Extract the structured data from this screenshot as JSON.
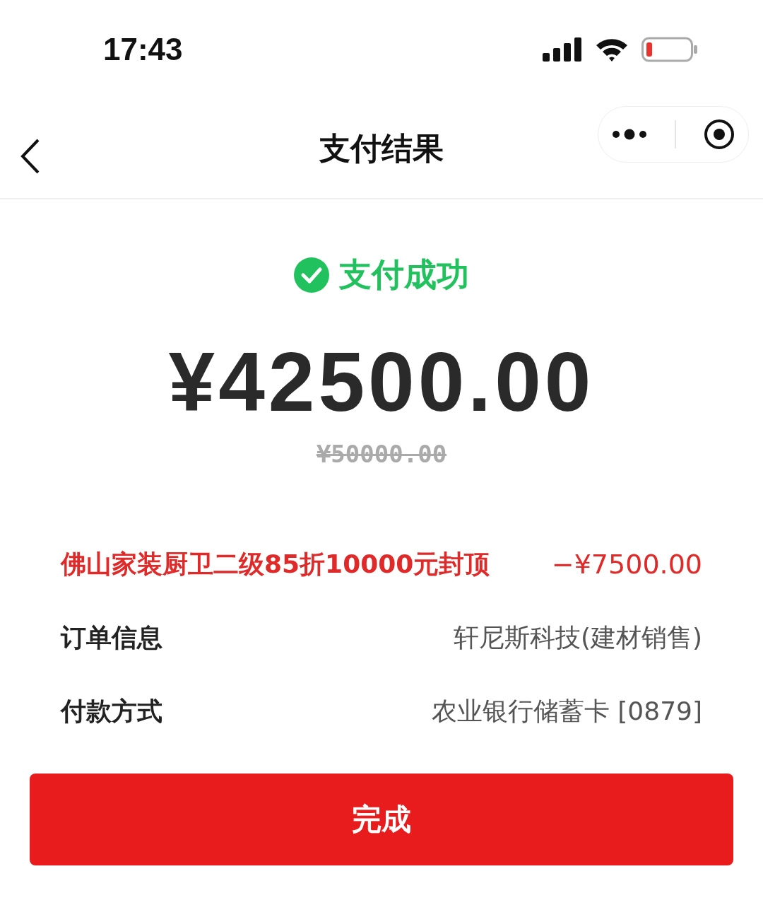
{
  "status_bar": {
    "time": "17:43"
  },
  "nav": {
    "title": "支付结果"
  },
  "result": {
    "status": "支付成功",
    "amount": "¥42500.00",
    "original_amount": "¥50000.00"
  },
  "discount": {
    "label": "佛山家装厨卫二级85折10000元封顶",
    "value": "−¥7500.00"
  },
  "details": [
    {
      "label": "订单信息",
      "value": "轩尼斯科技(建材销售)"
    },
    {
      "label": "付款方式",
      "value": "农业银行储蓄卡 [0879]"
    }
  ],
  "done_button": "完成"
}
